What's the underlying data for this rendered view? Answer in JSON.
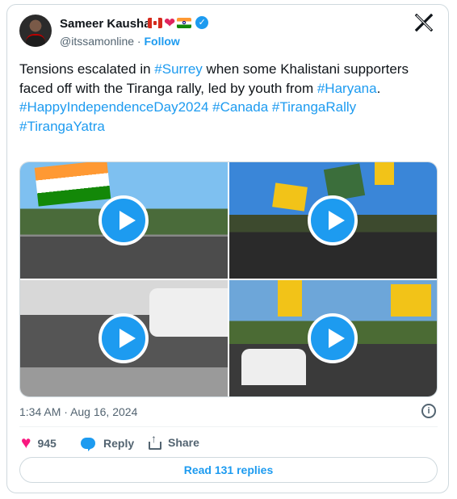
{
  "author": {
    "name": "Sameer Kaushal",
    "handle": "@itssamonline",
    "separator": "·",
    "follow_label": "Follow",
    "emoji": [
      "flag-canada",
      "red-heart",
      "flag-india"
    ],
    "verified": true
  },
  "tweet": {
    "segments": [
      {
        "text": "Tensions escalated in ",
        "type": "text"
      },
      {
        "text": "#Surrey",
        "type": "hashtag"
      },
      {
        "text": " when some Khalistani supporters faced off with the Tiranga rally, led by youth from ",
        "type": "text"
      },
      {
        "text": "#Haryana",
        "type": "hashtag"
      },
      {
        "text": ".",
        "type": "text"
      }
    ],
    "hashtags_line": [
      "#HappyIndependenceDay2024",
      "#Canada",
      "#TirangaRally",
      "#TirangaYatra"
    ]
  },
  "media": {
    "tiles": [
      {
        "kind": "video",
        "icon": "play-icon"
      },
      {
        "kind": "video",
        "icon": "play-icon"
      },
      {
        "kind": "video",
        "icon": "play-icon"
      },
      {
        "kind": "video",
        "icon": "play-icon"
      }
    ]
  },
  "meta": {
    "time": "1:34 AM",
    "separator": "·",
    "date": "Aug 16, 2024"
  },
  "actions": {
    "like_count": "945",
    "reply_label": "Reply",
    "share_label": "Share"
  },
  "read_replies_label": "Read 131 replies",
  "colors": {
    "accent": "#1d9bf0",
    "like": "#f91880",
    "muted": "#536471",
    "border": "#cfd9de"
  }
}
